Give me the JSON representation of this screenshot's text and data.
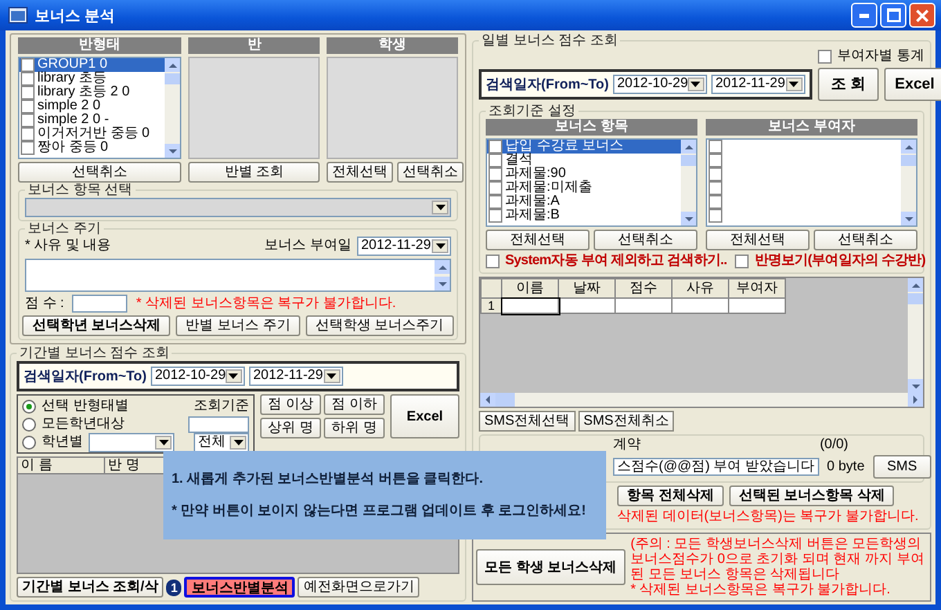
{
  "window": {
    "title": "보너스 분석"
  },
  "class_panel": {
    "lists": [
      {
        "header": "반형태",
        "disabled": false,
        "items": [
          {
            "label": "GROUP1 0",
            "checked": false,
            "selected": true
          },
          {
            "label": "library 초등",
            "checked": false,
            "selected": false
          },
          {
            "label": "library 초등 2 0",
            "checked": false,
            "selected": false
          },
          {
            "label": "simple 2 0",
            "checked": false,
            "selected": false
          },
          {
            "label": "simple 2 0 -",
            "checked": false,
            "selected": false
          },
          {
            "label": "이거저거반 중등 0",
            "checked": false,
            "selected": false
          },
          {
            "label": "짱아 중등 0",
            "checked": false,
            "selected": false
          }
        ],
        "buttons": [
          "선택취소"
        ]
      },
      {
        "header": "반",
        "disabled": true,
        "buttons": [
          "반별 조회"
        ]
      },
      {
        "header": "학생",
        "disabled": true,
        "buttons": [
          "전체선택",
          "선택취소"
        ]
      }
    ]
  },
  "bonus_item_select": {
    "title": "보너스 항목 선택",
    "disabled": true
  },
  "bonus_give": {
    "title": "보너스 주기",
    "reason_label": "* 사유 및 내용",
    "date_label": "보너스 부여일",
    "date": "2012-11-29",
    "score_label": "점 수 :",
    "warning": "* 삭제된 보너스항목은  복구가 불가합니다.",
    "buttons": [
      {
        "label": "선택학년 보너스삭제",
        "bold": true
      },
      {
        "label": "반별 보너스 주기",
        "bold": false
      },
      {
        "label": "선택학생 보너스주기",
        "bold": false
      }
    ]
  },
  "period_query": {
    "title": "기간별 보너스 점수 조회",
    "search": {
      "label": "검색일자(From~To)",
      "from": "2012-10-29",
      "to": "2012-11-29"
    },
    "radios": [
      {
        "label": "선택 반형태별",
        "selected": true
      },
      {
        "label": "모든학년대상",
        "selected": false
      },
      {
        "label": "학년별",
        "selected": false
      }
    ],
    "criteria_label": "조회기준",
    "grade_filter": "전체",
    "score_buttons": [
      "점 이상",
      "점 이하",
      "상위 명",
      "하위 명"
    ],
    "excel": "Excel",
    "columns": [
      "이 름",
      "반 명"
    ],
    "buttons": [
      {
        "label": "기간별 보너스 조회/삭",
        "kind": "normal"
      },
      {
        "label": "보너스반별분석",
        "kind": "highlight"
      },
      {
        "label": "예전화면으로가기",
        "kind": "normal"
      }
    ],
    "step_marker": "1"
  },
  "daily_query": {
    "title": "일별 보너스 점수 조회",
    "by_giver_stats": {
      "label": "부여자별 통계",
      "checked": false
    },
    "search": {
      "label": "검색일자(From~To)",
      "from": "2012-10-29",
      "to": "2012-11-29"
    },
    "query_button": "조 회",
    "excel": "Excel",
    "criteria": {
      "title": "조회기준 설정",
      "lists": [
        {
          "header": "보너스 항목",
          "items": [
            {
              "label": "납입 수강료 보너스",
              "checked": false,
              "selected": true
            },
            {
              "label": "결석",
              "checked": false,
              "selected": false
            },
            {
              "label": "과제물:90",
              "checked": false,
              "selected": false
            },
            {
              "label": "과제물:미제출",
              "checked": false,
              "selected": false
            },
            {
              "label": "과제물:A",
              "checked": false,
              "selected": false
            },
            {
              "label": "과제물:B",
              "checked": false,
              "selected": false
            }
          ],
          "buttons": [
            "전체선택",
            "선택취소"
          ]
        },
        {
          "header": "보너스 부여자",
          "items": [
            {
              "checked": false,
              "selected": false
            },
            {
              "checked": false,
              "selected": false
            },
            {
              "checked": false,
              "selected": false
            },
            {
              "checked": false,
              "selected": false
            },
            {
              "checked": false,
              "selected": false
            },
            {
              "checked": false,
              "selected": false
            }
          ],
          "buttons": [
            "전체선택",
            "선택취소"
          ]
        }
      ]
    },
    "options": [
      {
        "label": "System자동 부여 제외하고 검색하기..",
        "checked": false
      },
      {
        "label": "반명보기(부여일자의 수강반)",
        "checked": false
      }
    ]
  },
  "grid": {
    "columns": [
      "이름",
      "날짜",
      "점수",
      "사유",
      "부여자"
    ],
    "rows": [
      {
        "number": "1"
      }
    ]
  },
  "sms": {
    "buttons": [
      "SMS전체선택",
      "SMS전체취소"
    ],
    "reserve_label": "계약",
    "count": "(0/0)",
    "message": "스점수(@@점) 부여 받았습니다",
    "bytes": "0 byte",
    "send": "SMS"
  },
  "delete": {
    "buttons": [
      "항목 전체삭제",
      "선택된 보너스항목 삭제"
    ],
    "warning": "삭제된 데이터(보너스항목)는 복구가 불가합니다."
  },
  "reset": {
    "button": "모든 학생 보너스삭제",
    "notice": "(주의 : 모든 학생보너스삭제 버튼은 모든학생의 보너스점수가 0으로 초기화 되며 현재 까지 부여된 모든 보너스 항목은 삭제됩니다",
    "notice_2": "* 삭제된 보너스항목은  복구가 불가합니다."
  },
  "callout": {
    "lines": [
      "1. 새롭게 추가된 보너스반별분석 버튼을 클릭한다.",
      "* 만약 버튼이 보이지 않는다면 프로그램 업데이트 후 로그인하세요!"
    ]
  }
}
